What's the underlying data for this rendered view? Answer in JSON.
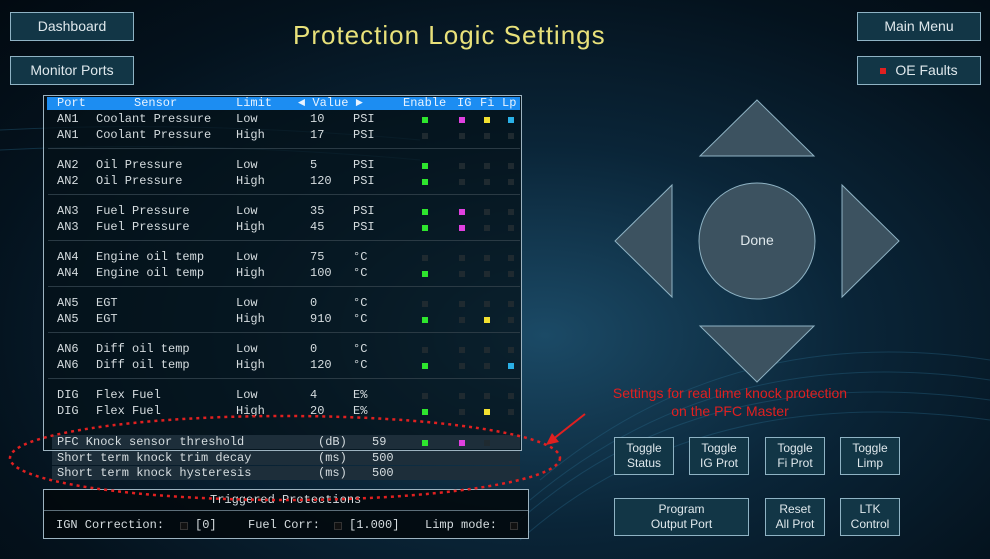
{
  "nav": {
    "dashboard": "Dashboard",
    "monitor_ports": "Monitor Ports",
    "main_menu": "Main Menu",
    "oe_faults": "OE Faults"
  },
  "page_title": "Protection Logic Settings",
  "table": {
    "headers": {
      "port": "Port",
      "sensor": "Sensor",
      "limit": "Limit",
      "value": "◄ Value ►",
      "enable": "Enable",
      "ig": "IG",
      "fi": "Fi",
      "lp": "Lp"
    },
    "rows": [
      {
        "port": "AN1",
        "sensor": "Coolant Pressure",
        "limit": "Low",
        "value": "10",
        "unit": "PSI",
        "enable": true,
        "ig": true,
        "fi": true,
        "lp": true
      },
      {
        "port": "AN1",
        "sensor": "Coolant Pressure",
        "limit": "High",
        "value": "17",
        "unit": "PSI",
        "enable": false,
        "ig": false,
        "fi": false,
        "lp": false
      },
      {
        "port": "AN2",
        "sensor": "Oil Pressure",
        "limit": "Low",
        "value": "5",
        "unit": "PSI",
        "enable": true,
        "ig": false,
        "fi": false,
        "lp": false
      },
      {
        "port": "AN2",
        "sensor": "Oil Pressure",
        "limit": "High",
        "value": "120",
        "unit": "PSI",
        "enable": true,
        "ig": false,
        "fi": false,
        "lp": false
      },
      {
        "port": "AN3",
        "sensor": "Fuel Pressure",
        "limit": "Low",
        "value": "35",
        "unit": "PSI",
        "enable": true,
        "ig": true,
        "fi": false,
        "lp": false
      },
      {
        "port": "AN3",
        "sensor": "Fuel Pressure",
        "limit": "High",
        "value": "45",
        "unit": "PSI",
        "enable": true,
        "ig": true,
        "fi": false,
        "lp": false
      },
      {
        "port": "AN4",
        "sensor": "Engine oil temp",
        "limit": "Low",
        "value": "75",
        "unit": "°C",
        "enable": false,
        "ig": false,
        "fi": false,
        "lp": false
      },
      {
        "port": "AN4",
        "sensor": "Engine oil temp",
        "limit": "High",
        "value": "100",
        "unit": "°C",
        "enable": true,
        "ig": false,
        "fi": false,
        "lp": false
      },
      {
        "port": "AN5",
        "sensor": "EGT",
        "limit": "Low",
        "value": "0",
        "unit": "°C",
        "enable": false,
        "ig": false,
        "fi": false,
        "lp": false
      },
      {
        "port": "AN5",
        "sensor": "EGT",
        "limit": "High",
        "value": "910",
        "unit": "°C",
        "enable": true,
        "ig": false,
        "fi": true,
        "lp": false
      },
      {
        "port": "AN6",
        "sensor": "Diff oil temp",
        "limit": "Low",
        "value": "0",
        "unit": "°C",
        "enable": false,
        "ig": false,
        "fi": false,
        "lp": false
      },
      {
        "port": "AN6",
        "sensor": "Diff oil temp",
        "limit": "High",
        "value": "120",
        "unit": "°C",
        "enable": true,
        "ig": false,
        "fi": false,
        "lp": true
      },
      {
        "port": "DIG",
        "sensor": "Flex Fuel",
        "limit": "Low",
        "value": "4",
        "unit": "E%",
        "enable": false,
        "ig": false,
        "fi": false,
        "lp": false
      },
      {
        "port": "DIG",
        "sensor": "Flex Fuel",
        "limit": "High",
        "value": "20",
        "unit": "E%",
        "enable": true,
        "ig": false,
        "fi": true,
        "lp": false
      }
    ],
    "knock": [
      {
        "label": "PFC Knock sensor threshold",
        "unit": "(dB)",
        "value": "59",
        "enable": true,
        "ig": true
      },
      {
        "label": "Short term knock trim decay",
        "unit": "(ms)",
        "value": "500"
      },
      {
        "label": "Short term knock hysteresis",
        "unit": "(ms)",
        "value": "500"
      }
    ]
  },
  "triggered": {
    "title": "Triggered Protections",
    "ign_label": "IGN Correction:",
    "ign_value": "[0]",
    "fuel_label": "Fuel Corr:",
    "fuel_value": "[1.000]",
    "limp_label": "Limp mode:"
  },
  "dpad": {
    "done": "Done"
  },
  "annotation": {
    "line1": "Settings for real time knock protection",
    "line2": "on the PFC Master"
  },
  "buttons": {
    "toggle_status": [
      "Toggle",
      "Status"
    ],
    "toggle_ig": [
      "Toggle",
      "IG Prot"
    ],
    "toggle_fi": [
      "Toggle",
      "Fi Prot"
    ],
    "toggle_limp": [
      "Toggle",
      "Limp"
    ],
    "program_output": [
      "Program",
      "Output Port"
    ],
    "reset_all": [
      "Reset",
      "All Prot"
    ],
    "ltk_control": [
      "LTK",
      "Control"
    ]
  },
  "colors": {
    "enable": "#2ee62e",
    "ig": "#e040e0",
    "fi": "#f2e030",
    "lp": "#2ab0e6",
    "off": "#1f2a30",
    "header": "#1c8df2",
    "title": "#e8e17a",
    "annotation": "#e02020"
  }
}
